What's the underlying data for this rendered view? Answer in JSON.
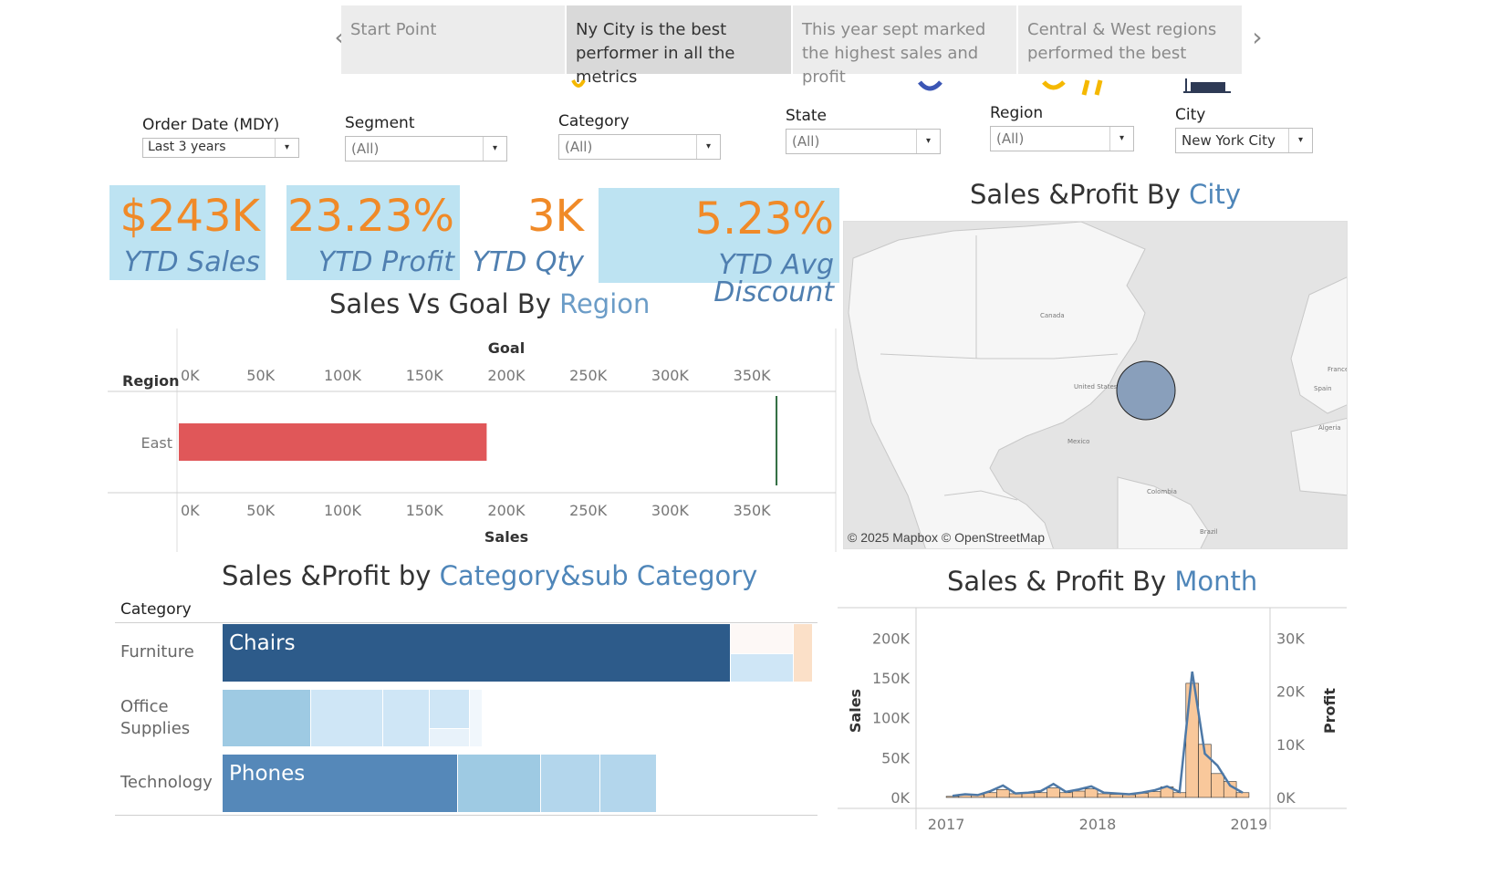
{
  "story": {
    "points": [
      {
        "label": "Start Point"
      },
      {
        "label": "Ny City is the best performer in all the metrics"
      },
      {
        "label": "This year sept marked the highest sales and profit"
      },
      {
        "label": "Central & West regions performed the best"
      }
    ],
    "prev_icon": "chevron-left-icon",
    "next_icon": "chevron-right-icon",
    "prev_glyph": "‹",
    "next_glyph": "›"
  },
  "filters": {
    "order_date": {
      "label": "Order Date (MDY)",
      "value": "Last 3 years"
    },
    "segment": {
      "label": "Segment",
      "value": "(All)"
    },
    "category": {
      "label": "Category",
      "value": "(All)"
    },
    "state": {
      "label": "State",
      "value": "(All)"
    },
    "region": {
      "label": "Region",
      "value": "(All)"
    },
    "city": {
      "label": "City",
      "value": "New York City"
    },
    "dropdown_glyph": "▾"
  },
  "kpis": [
    {
      "value": "$243K",
      "label": "YTD Sales"
    },
    {
      "value": "23.23%",
      "label": "YTD Profit"
    },
    {
      "value": "3K",
      "label": "YTD Qty"
    },
    {
      "value": "5.23%",
      "label": "YTD Avg Discount"
    }
  ],
  "titles": {
    "sales_goal": {
      "prefix": "Sales Vs Goal By ",
      "highlight": "Region"
    },
    "map": {
      "prefix": "Sales &Profit By ",
      "highlight": "City"
    },
    "treemap": {
      "prefix": "Sales &Profit by ",
      "highlight": "Category&sub Category"
    },
    "month": {
      "prefix": "Sales & Profit By ",
      "highlight": "Month"
    }
  },
  "map": {
    "attribution": "© 2025 Mapbox © OpenStreetMap",
    "labels": [
      "Canada",
      "United States",
      "Mexico",
      "Colombia",
      "Brazil",
      "Spain",
      "France",
      "Algeria"
    ]
  },
  "colors": {
    "kpi_bg": "#bde3f2",
    "kpi_value": "#f08a28",
    "kpi_label": "#4f7fb0",
    "bar_sales": "#e05759",
    "goal_line": "#2e6b3f",
    "line_sales": "#4e79a7",
    "bar_profit": "#f9c89b"
  },
  "treemap": {
    "header": "Category",
    "categories": [
      "Furniture",
      "Office Supplies",
      "Technology"
    ],
    "labels": {
      "chairs": "Chairs",
      "phones": "Phones"
    }
  },
  "chart_data": [
    {
      "type": "bar",
      "title": "Sales Vs Goal By Region",
      "row_header": "Region",
      "categories": [
        "East"
      ],
      "series": [
        {
          "name": "Sales",
          "values": [
            188000
          ]
        },
        {
          "name": "Goal",
          "values": [
            365000
          ]
        }
      ],
      "xlabel_top": "Goal",
      "xlabel": "Sales",
      "xlim": [
        0,
        380000
      ],
      "ticks": [
        "0K",
        "50K",
        "100K",
        "150K",
        "200K",
        "250K",
        "300K",
        "350K"
      ]
    },
    {
      "type": "line",
      "title": "Sales & Profit By Month",
      "ylabel": "Sales",
      "y2label": "Profit",
      "ylim": [
        0,
        220000
      ],
      "y2lim": [
        0,
        33000
      ],
      "yticks": [
        "0K",
        "50K",
        "100K",
        "150K",
        "200K"
      ],
      "y2ticks": [
        "0K",
        "10K",
        "20K",
        "30K"
      ],
      "xticks": [
        "2017",
        "2018",
        "2019"
      ],
      "months": [
        "2017-01",
        "2017-02",
        "2017-03",
        "2017-04",
        "2017-05",
        "2017-06",
        "2017-07",
        "2017-08",
        "2017-09",
        "2017-10",
        "2017-11",
        "2017-12",
        "2018-01",
        "2018-02",
        "2018-03",
        "2018-04",
        "2018-05",
        "2018-06",
        "2018-07",
        "2018-08",
        "2018-09",
        "2018-10",
        "2018-11",
        "2018-12"
      ],
      "series": [
        {
          "name": "Sales",
          "values": [
            2000,
            4000,
            3000,
            8000,
            15000,
            5000,
            6000,
            8000,
            17000,
            7000,
            10000,
            14000,
            6000,
            5000,
            4000,
            6000,
            9000,
            14000,
            7000,
            158000,
            55000,
            40000,
            15000,
            6000
          ]
        },
        {
          "name": "Profit",
          "values": [
            200,
            600,
            500,
            900,
            1500,
            700,
            800,
            900,
            1800,
            900,
            1200,
            1600,
            700,
            600,
            500,
            800,
            1100,
            2000,
            900,
            21500,
            10000,
            4500,
            3000,
            900
          ]
        }
      ]
    }
  ]
}
